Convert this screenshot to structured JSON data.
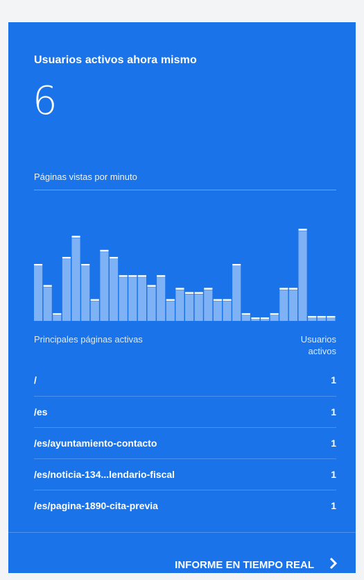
{
  "card": {
    "title": "Usuarios activos ahora mismo",
    "active_users": "6",
    "pageviews_title": "Páginas vistas por minuto"
  },
  "chart_data": {
    "type": "bar",
    "title": "Páginas vistas por minuto",
    "values": [
      4,
      2.5,
      0.5,
      4.5,
      6,
      4,
      1.5,
      5,
      4.5,
      3.2,
      3.2,
      3.2,
      2.5,
      3.2,
      1.5,
      2.3,
      2,
      2,
      2.3,
      1.5,
      1.5,
      4,
      0.5,
      0.2,
      0.2,
      0.5,
      2.3,
      2.3,
      6.5,
      0.3,
      0.3,
      0.3
    ],
    "ylim": [
      0,
      8
    ],
    "bar_color": "#7fb2f5",
    "cap_color": "#ffffff"
  },
  "table": {
    "col1": "Principales páginas activas",
    "col2_line1": "Usuarios",
    "col2_line2": "activos",
    "rows": [
      {
        "path": "/",
        "count": "1"
      },
      {
        "path": "/es",
        "count": "1"
      },
      {
        "path": "/es/ayuntamiento-contacto",
        "count": "1"
      },
      {
        "path": "/es/noticia-134...lendario-fiscal",
        "count": "1"
      },
      {
        "path": "/es/pagina-1890-cita-previa",
        "count": "1"
      }
    ]
  },
  "footer": {
    "link_label": "INFORME EN TIEMPO REAL",
    "chevron_icon": "chevron-right-icon"
  },
  "colors": {
    "card_bg": "#1a73e8",
    "page_bg": "#f3f4f6"
  }
}
